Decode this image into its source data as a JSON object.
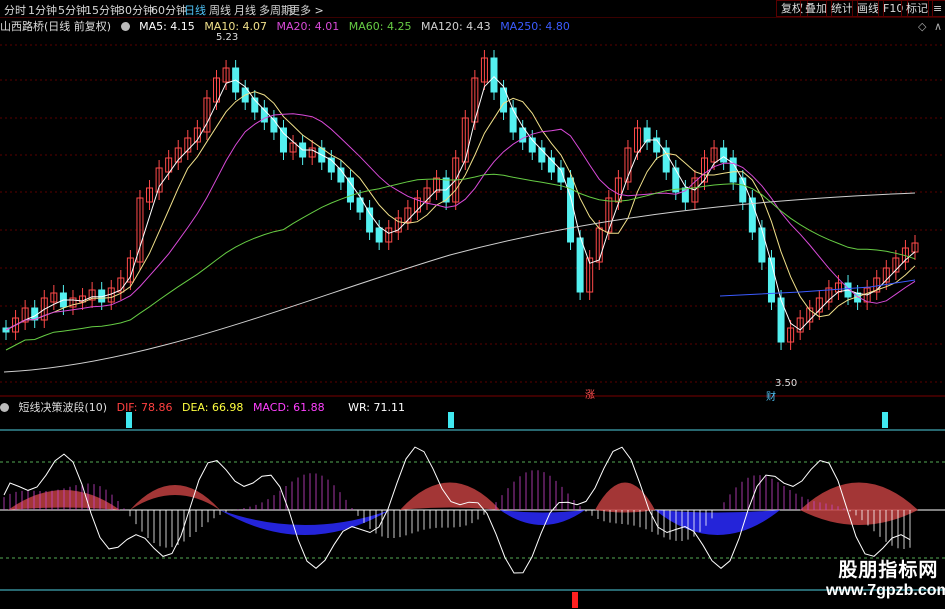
{
  "toolbar": {
    "periods": [
      "分时",
      "1分钟",
      "5分钟",
      "15分钟",
      "30分钟",
      "60分钟",
      "日线",
      "周线",
      "月线",
      "多周期",
      "更多 >"
    ],
    "active_period": "日线",
    "right_buttons": [
      "复权",
      "叠加",
      "统计",
      "画线",
      "F10",
      "标记"
    ]
  },
  "main": {
    "title": "山西路桥(日线 前复权)",
    "ma": [
      {
        "label": "MA5: 4.15",
        "color": "#ffffff"
      },
      {
        "label": "MA10: 4.07",
        "color": "#f0e08a"
      },
      {
        "label": "MA20: 4.01",
        "color": "#d84ad8"
      },
      {
        "label": "MA60: 4.25",
        "color": "#66cc44"
      },
      {
        "label": "MA120: 4.43",
        "color": "#d0d0d0"
      },
      {
        "label": "MA250: 4.80",
        "color": "#3b5bff"
      }
    ],
    "high_label": "5.23",
    "low_label": "3.50",
    "marker_rise": "涨",
    "marker_fin": "财"
  },
  "indicator": {
    "title": "短线决策波段(10)",
    "values": [
      {
        "label": "DIF: 78.86",
        "color": "#ff4040"
      },
      {
        "label": "DEA: 66.98",
        "color": "#ffff40"
      },
      {
        "label": "MACD: 61.88",
        "color": "#ff40ff"
      },
      {
        "label": "WR: 71.11",
        "color": "#ffffff"
      }
    ]
  },
  "watermark": {
    "line1": "股朋指标网",
    "line2": "www.7gpzb.com"
  },
  "colors": {
    "up": "#ff4a4a",
    "down": "#54f0f0",
    "grid": "#5a0000"
  }
}
